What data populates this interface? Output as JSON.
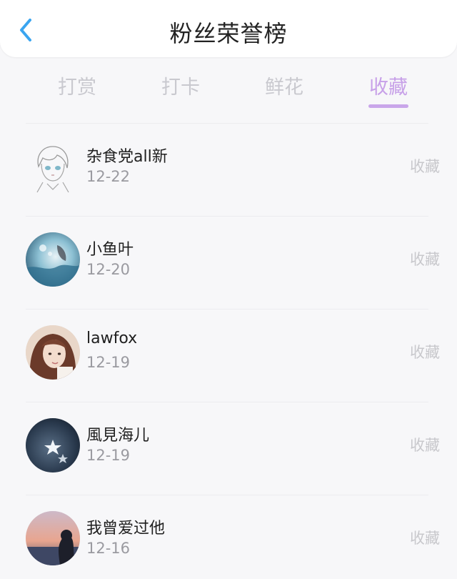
{
  "header": {
    "title": "粉丝荣誉榜"
  },
  "tabs": [
    {
      "label": "打赏"
    },
    {
      "label": "打卡"
    },
    {
      "label": "鲜花"
    },
    {
      "label": "收藏"
    }
  ],
  "active_tab": "收藏",
  "colors": {
    "accent": "#c9a6ea",
    "back_arrow": "#3aa5f0"
  },
  "list": {
    "items": [
      {
        "name": "杂食党all新",
        "date": "12-22",
        "action": "收藏",
        "avatar": "sketch-boy-avatar"
      },
      {
        "name": "小鱼叶",
        "date": "12-20",
        "action": "收藏",
        "avatar": "underwater-avatar"
      },
      {
        "name": "lawfox",
        "date": "12-19",
        "action": "收藏",
        "avatar": "girl-portrait-avatar"
      },
      {
        "name": "風見海儿",
        "date": "12-19",
        "action": "收藏",
        "avatar": "night-star-avatar"
      },
      {
        "name": "我曾爱过他",
        "date": "12-16",
        "action": "收藏",
        "avatar": "sunset-silhouette-avatar"
      }
    ]
  }
}
